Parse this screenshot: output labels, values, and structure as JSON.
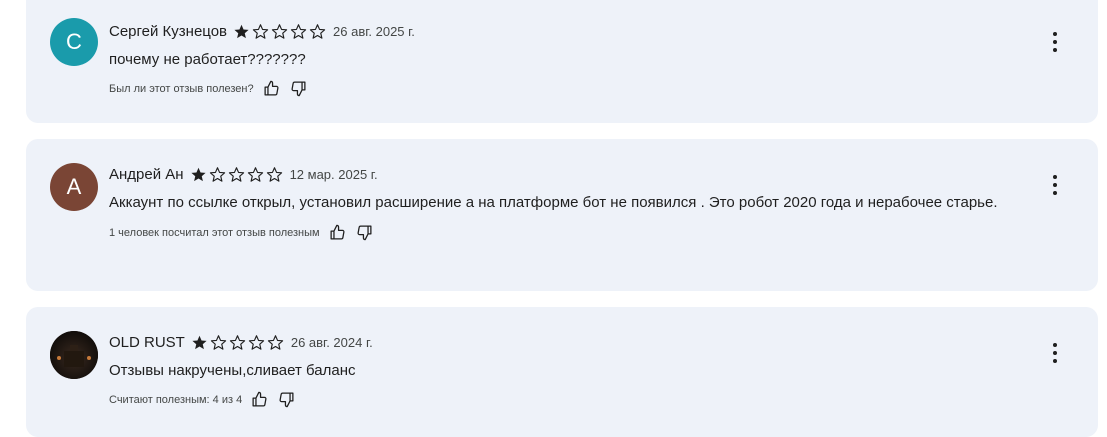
{
  "reviews": [
    {
      "avatar_letter": "С",
      "avatar_color": "#1a9bab",
      "author": "Сергей Кузнецов",
      "rating": 1,
      "date": "26 авг. 2025 г.",
      "text": "почему не работает???????",
      "helpful_text": "Был ли этот отзыв полезен?"
    },
    {
      "avatar_letter": "А",
      "avatar_color": "#7a4535",
      "author": "Андрей Ан",
      "rating": 1,
      "date": "12 мар. 2025 г.",
      "text": "Аккаунт по ссылке открыл, установил расширение а на платформе бот не появился . Это робот 2020 года и нерабочее старье.",
      "helpful_text": "1 человек посчитал этот отзыв полезным"
    },
    {
      "avatar_letter": "",
      "avatar_color": "#1c1410",
      "author": "OLD RUST",
      "rating": 1,
      "date": "26 авг. 2024 г.",
      "text": "Отзывы накручены,сливает баланс",
      "helpful_text": "Считают полезным: 4 из 4"
    }
  ],
  "icons": {
    "star_filled": "star-filled-icon",
    "star_empty": "star-outline-icon",
    "thumb_up": "thumb-up-icon",
    "thumb_down": "thumb-down-icon",
    "menu": "more-vert-icon"
  }
}
